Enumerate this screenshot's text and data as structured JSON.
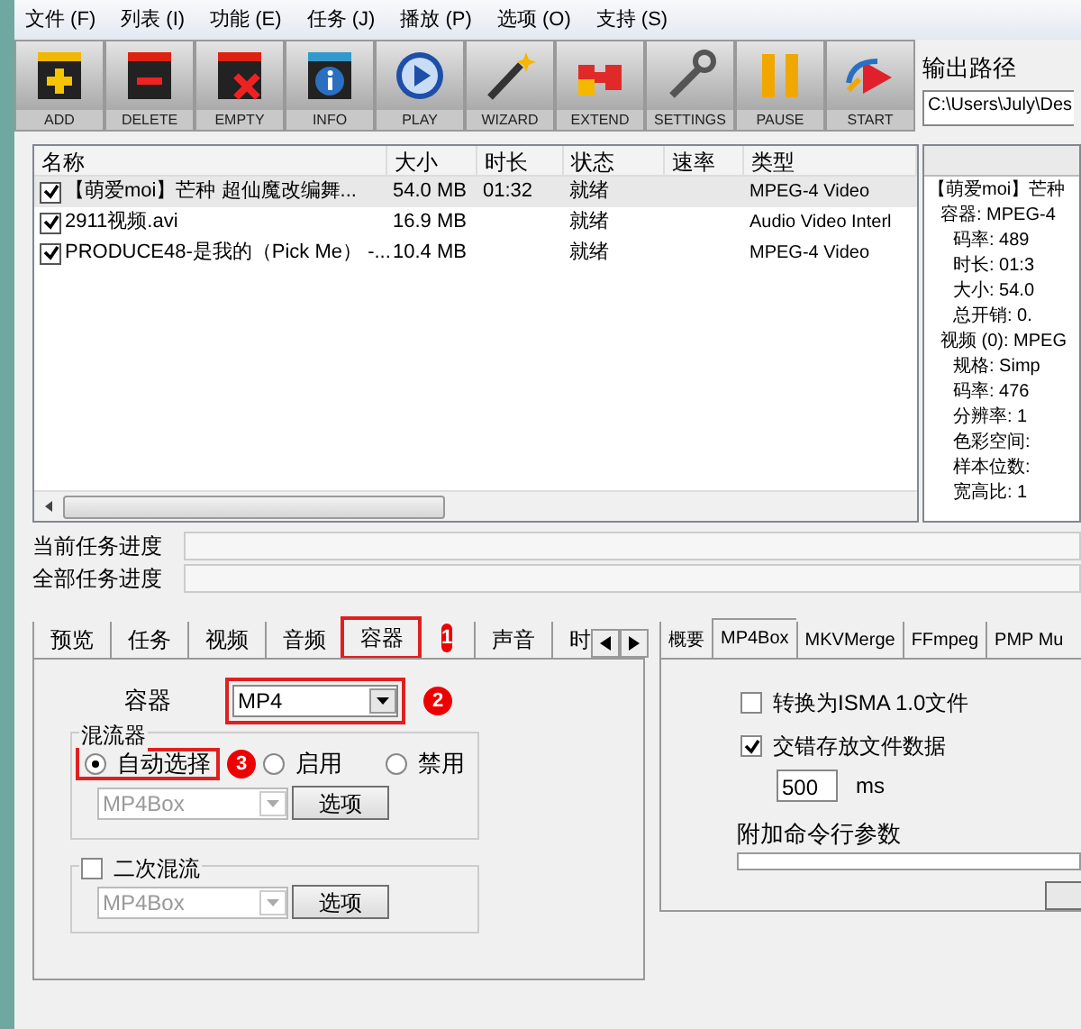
{
  "menu": [
    "文件 (F)",
    "列表 (I)",
    "功能 (E)",
    "任务 (J)",
    "播放 (P)",
    "选项 (O)",
    "支持 (S)"
  ],
  "toolbar": [
    {
      "kind": "add",
      "label": "ADD"
    },
    {
      "kind": "delete",
      "label": "DELETE"
    },
    {
      "kind": "empty",
      "label": "EMPTY"
    },
    {
      "kind": "info",
      "label": "INFO"
    },
    {
      "kind": "play",
      "label": "PLAY"
    },
    {
      "kind": "wizard",
      "label": "WIZARD"
    },
    {
      "kind": "extend",
      "label": "EXTEND"
    },
    {
      "kind": "settings",
      "label": "SETTINGS"
    },
    {
      "kind": "pause",
      "label": "PAUSE"
    },
    {
      "kind": "start",
      "label": "START"
    }
  ],
  "output": {
    "label": "输出路径",
    "value": "C:\\Users\\July\\Des"
  },
  "file_list": {
    "columns": [
      "名称",
      "大小",
      "时长",
      "状态",
      "速率",
      "类型"
    ],
    "rows": [
      {
        "checked": true,
        "selected": true,
        "cells": [
          "【萌爱moi】芒种 超仙魔改编舞...",
          "54.0 MB",
          "01:32",
          "就绪",
          "",
          "MPEG-4 Video"
        ]
      },
      {
        "checked": true,
        "selected": false,
        "cells": [
          "2911视频.avi",
          "16.9 MB",
          "",
          "就绪",
          "",
          "Audio Video Interl"
        ]
      },
      {
        "checked": true,
        "selected": false,
        "cells": [
          "PRODUCE48-是我的（Pick Me） -...",
          "10.4 MB",
          "",
          "就绪",
          "",
          "MPEG-4 Video"
        ]
      }
    ]
  },
  "info_tree": [
    {
      "label": "【萌爱moi】芒种",
      "children": [
        {
          "label": "容器: MPEG-4",
          "children": [
            {
              "label": "码率: 489"
            },
            {
              "label": "时长: 01:3"
            },
            {
              "label": "大小: 54.0"
            },
            {
              "label": "总开销: 0."
            }
          ]
        },
        {
          "label": "视频 (0): MPEG",
          "children": [
            {
              "label": "规格: Simp"
            },
            {
              "label": "码率: 476"
            },
            {
              "label": "分辨率: 1"
            },
            {
              "label": "色彩空间:"
            },
            {
              "label": "样本位数:"
            },
            {
              "label": "宽高比: 1"
            }
          ]
        }
      ]
    }
  ],
  "progress": [
    {
      "label": "当前任务进度",
      "level": 0
    },
    {
      "label": "全部任务进度",
      "level": 0
    }
  ],
  "left_tabs": [
    {
      "label": "预览",
      "selected": false
    },
    {
      "label": "任务",
      "selected": false
    },
    {
      "label": "视频",
      "selected": false
    },
    {
      "label": "音频",
      "selected": false
    },
    {
      "label": "容器",
      "selected": true,
      "highlighted": true,
      "badge": "1"
    },
    {
      "label": "声音",
      "selected": false
    },
    {
      "label": "时",
      "selected": false
    }
  ],
  "container": {
    "label": "容器",
    "value": "MP4",
    "badge": "2"
  },
  "muxer": {
    "title": "混流器",
    "options": [
      {
        "label": "自动选择",
        "selected": true,
        "badge": "3"
      },
      {
        "label": "启用",
        "selected": false
      },
      {
        "label": "禁用",
        "selected": false
      }
    ],
    "select": "MP4Box",
    "button": "选项"
  },
  "second_mux": {
    "title": "二次混流",
    "checked": false,
    "select": "MP4Box",
    "button": "选项"
  },
  "right_tabs": [
    {
      "label": "概要",
      "selected": false
    },
    {
      "label": "MP4Box",
      "selected": true
    },
    {
      "label": "MKVMerge",
      "selected": false
    },
    {
      "label": "FFmpeg",
      "selected": false
    },
    {
      "label": "PMP Mu",
      "selected": false
    }
  ],
  "mp4box": {
    "options": [
      {
        "label": "转换为ISMA 1.0文件",
        "checked": false
      },
      {
        "label": "交错存放文件数据",
        "checked": true
      }
    ],
    "interleave": "500",
    "unit": "ms",
    "args_label": "附加命令行参数"
  }
}
